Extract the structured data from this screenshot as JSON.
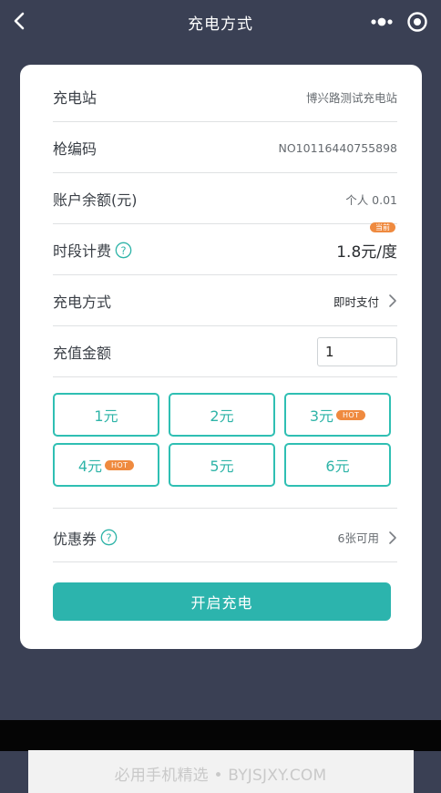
{
  "nav": {
    "title": "充电方式"
  },
  "station": {
    "label": "充电站",
    "value": "博兴路测试充电站"
  },
  "gun": {
    "label": "枪编码",
    "value": "NO10116440755898"
  },
  "balance": {
    "label": "账户余额(元)",
    "value": "个人 0.01"
  },
  "fee": {
    "label": "时段计费",
    "badge": "当前",
    "price": "1.8元/度"
  },
  "charge_method": {
    "label": "充电方式",
    "value": "即时支付"
  },
  "recharge": {
    "label": "充值金额",
    "input_value": "1"
  },
  "options": [
    {
      "label": "1元",
      "badge": ""
    },
    {
      "label": "2元",
      "badge": ""
    },
    {
      "label": "3元",
      "badge": "HOT"
    },
    {
      "label": "4元",
      "badge": "HOT"
    },
    {
      "label": "5元",
      "badge": ""
    },
    {
      "label": "6元",
      "badge": ""
    }
  ],
  "coupon": {
    "label": "优惠券",
    "value": "6张可用"
  },
  "start_button": "开启充电",
  "watermark": "必用手机精选 • BYJSJXY.COM",
  "colors": {
    "accent": "#2cb4ad",
    "hot": "#ef8a3f",
    "background": "#3a4054"
  },
  "icons": [
    "back-icon",
    "more-icon",
    "target-icon",
    "help-icon",
    "chevron-right-icon"
  ]
}
